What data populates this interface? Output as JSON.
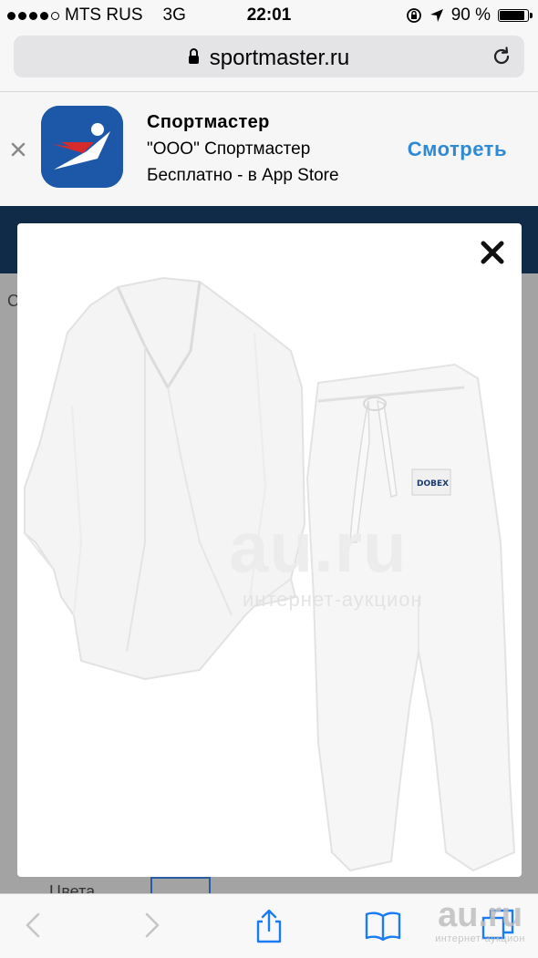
{
  "status_bar": {
    "carrier": "MTS RUS",
    "network": "3G",
    "time": "22:01",
    "battery": "90 %",
    "battery_level": 0.9,
    "signal_bars_filled": 4,
    "signal_bars_total": 5
  },
  "address_bar": {
    "url": "sportmaster.ru",
    "lock_icon": "lock-icon",
    "reload_icon": "reload-icon"
  },
  "app_banner": {
    "app_name": "Спортмастер",
    "company": "\"ООО\" Спортмастер",
    "price": "Бесплатно - в App Store",
    "view_label": "Смотреть",
    "view_color": "#2f8ad6",
    "icon_bg": "#1d58a8"
  },
  "page": {
    "edge_letter": "С",
    "colors_label": "Цвета",
    "header_color": "#0f2b48"
  },
  "modal": {
    "close_icon": "close-icon",
    "image": {
      "alt": "judo-kimono",
      "pants_label": "DOBEX",
      "watermark_main": "au.ru",
      "watermark_sub": "интернет-аукцион"
    }
  },
  "toolbar": {
    "icons": [
      "back-icon",
      "forward-icon",
      "share-icon",
      "bookmarks-icon",
      "tabs-icon"
    ],
    "accent": "#1a7cf5"
  },
  "corner_watermark": {
    "main": "au.ru",
    "sub": "интернет-аукцион"
  }
}
